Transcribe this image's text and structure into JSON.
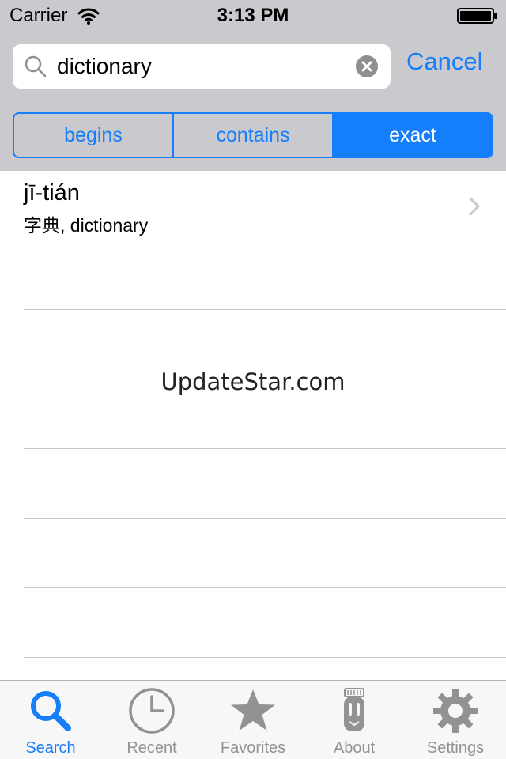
{
  "status_bar": {
    "carrier": "Carrier",
    "time": "3:13 PM"
  },
  "search": {
    "value": "dictionary",
    "cancel_label": "Cancel"
  },
  "segments": {
    "items": [
      {
        "label": "begins",
        "selected": false
      },
      {
        "label": "contains",
        "selected": false
      },
      {
        "label": "exact",
        "selected": true
      }
    ]
  },
  "results": [
    {
      "pinyin": "jī-tián",
      "definition": "字典, dictionary"
    }
  ],
  "watermark": "UpdateStar.com",
  "tabs": [
    {
      "label": "Search",
      "icon": "search-icon",
      "selected": true
    },
    {
      "label": "Recent",
      "icon": "clock-icon",
      "selected": false
    },
    {
      "label": "Favorites",
      "icon": "star-icon",
      "selected": false
    },
    {
      "label": "About",
      "icon": "about-icon",
      "selected": false
    },
    {
      "label": "Settings",
      "icon": "gear-icon",
      "selected": false
    }
  ],
  "colors": {
    "accent": "#147efb",
    "bar_gray": "#c9c9ce",
    "tab_inactive": "#929292"
  }
}
